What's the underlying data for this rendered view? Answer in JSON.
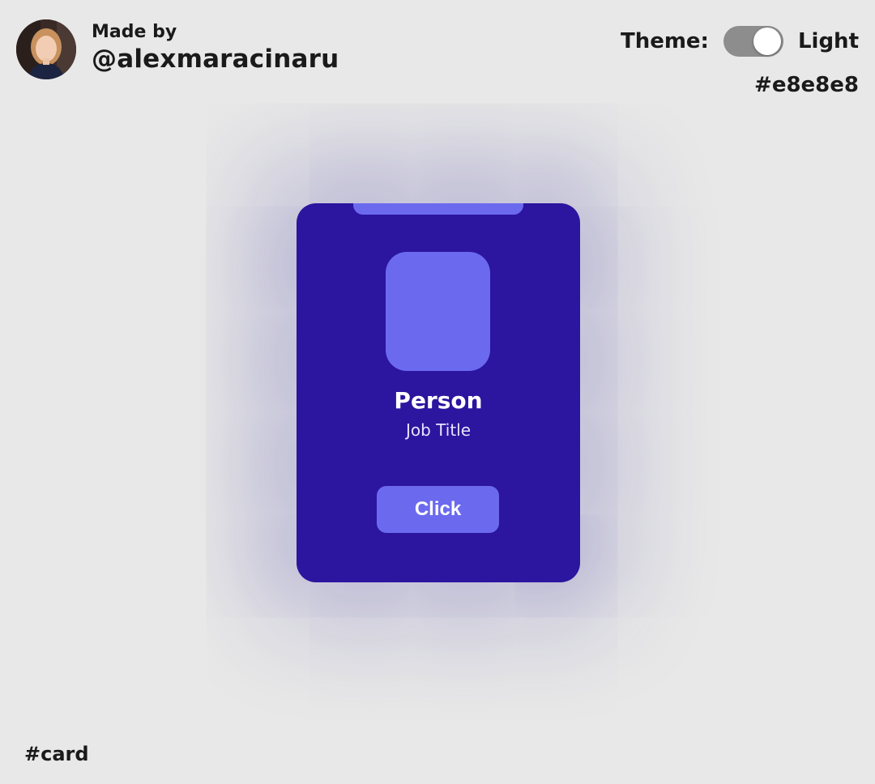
{
  "author": {
    "made_by_label": "Made by",
    "handle": "@alexmaracinaru"
  },
  "theme": {
    "label": "Theme:",
    "value": "Light",
    "hex": "#e8e8e8",
    "toggle_on": true
  },
  "card": {
    "name": "Person",
    "job_title": "Job Title",
    "button_label": "Click"
  },
  "footer": {
    "label": "#card"
  },
  "colors": {
    "background": "#e8e8e8",
    "card": "#2c159f",
    "accent": "#6b6aef",
    "toggle_track": "#8d8d8d"
  },
  "icons": {
    "avatar": "avatar-photo"
  }
}
